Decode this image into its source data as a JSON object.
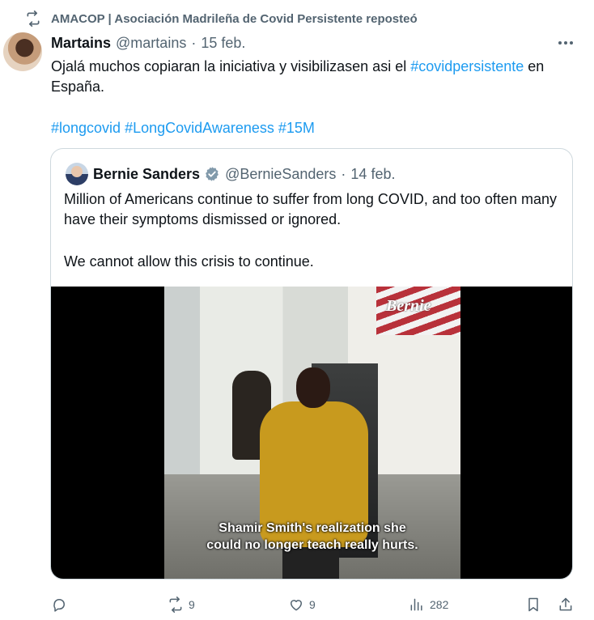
{
  "social_context": {
    "text": "AMACOP | Asociación Madrileña de Covid Persistente reposteó",
    "icon": "repost-icon"
  },
  "tweet": {
    "author_name": "Martains",
    "author_handle": "@martains",
    "separator": "·",
    "date": "15 feb.",
    "more_icon": "more-icon",
    "text_part1": "Ojalá muchos copiaran la iniciativa y visibilizasen asi el ",
    "text_link": "#covidpersistente",
    "text_part2": " en España.",
    "hashtags": [
      "#longcovid",
      "#LongCovidAwareness",
      "#15M"
    ]
  },
  "quoted_tweet": {
    "author_name": "Bernie Sanders",
    "author_handle": "@BernieSanders",
    "separator": "·",
    "date": "14 feb.",
    "verified_icon": "verified-badge-icon",
    "paragraph1": "Million of Americans continue to suffer from long COVID, and too often many have their symptoms dismissed or ignored.",
    "paragraph2": "We cannot allow this crisis to continue.",
    "video": {
      "watermark": "Bernie",
      "caption_line1": "Shamir Smith's realization she",
      "caption_line2": "could no longer teach really hurts."
    }
  },
  "actions": {
    "reply": {
      "icon": "reply-icon",
      "count": ""
    },
    "repost": {
      "icon": "repost-icon",
      "count": "9"
    },
    "like": {
      "icon": "like-icon",
      "count": "9"
    },
    "views": {
      "icon": "views-icon",
      "count": "282"
    },
    "bookmark": {
      "icon": "bookmark-icon",
      "count": ""
    },
    "share": {
      "icon": "share-icon",
      "count": ""
    }
  },
  "colors": {
    "accent": "#1d9bf0",
    "secondary_text": "#536471",
    "text": "#0f1419",
    "border": "#cfd9de"
  }
}
